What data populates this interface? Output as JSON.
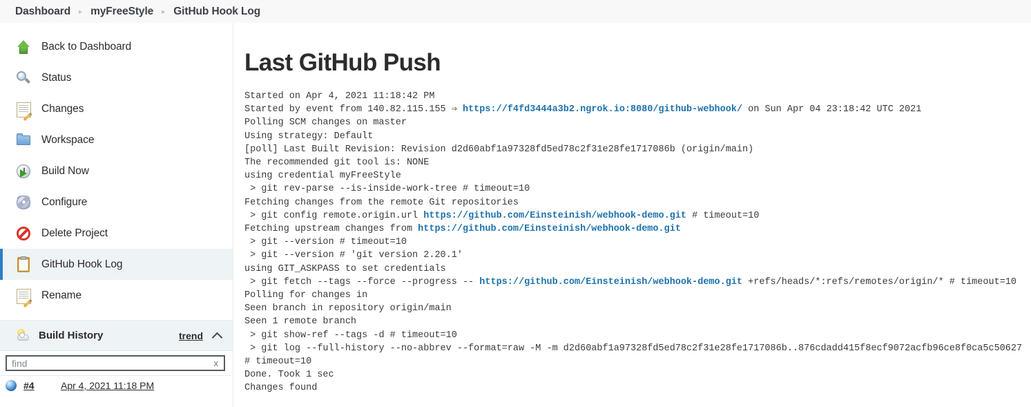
{
  "breadcrumb": {
    "items": [
      {
        "label": "Dashboard"
      },
      {
        "label": "myFreeStyle"
      },
      {
        "label": "GitHub Hook Log"
      }
    ],
    "separator": "▸"
  },
  "sidebar": {
    "tasks": [
      {
        "label": "Back to Dashboard",
        "icon": "arrow-up-icon",
        "active": false
      },
      {
        "label": "Status",
        "icon": "magnifier-icon",
        "active": false
      },
      {
        "label": "Changes",
        "icon": "notepad-pencil-icon",
        "active": false
      },
      {
        "label": "Workspace",
        "icon": "folder-icon",
        "active": false
      },
      {
        "label": "Build Now",
        "icon": "clock-play-icon",
        "active": false
      },
      {
        "label": "Configure",
        "icon": "gear-icon",
        "active": false
      },
      {
        "label": "Delete Project",
        "icon": "deny-icon",
        "active": false
      },
      {
        "label": "GitHub Hook Log",
        "icon": "clipboard-icon",
        "active": true
      },
      {
        "label": "Rename",
        "icon": "notepad-pencil-icon",
        "active": false
      }
    ],
    "build_history": {
      "title": "Build History",
      "icon": "weather-sun-cloud-icon",
      "trend_label": "trend",
      "collapse_icon": "chevron-up-icon",
      "find": {
        "value": "",
        "placeholder": "find",
        "clear_label": "x"
      },
      "builds": [
        {
          "number": "#4",
          "date": "Apr 4, 2021 11:18 PM",
          "status_icon": "blue-ball-icon"
        }
      ]
    }
  },
  "main": {
    "title": "Last GitHub Push",
    "console": {
      "lines": [
        {
          "segments": [
            {
              "text": "Started on Apr 4, 2021 11:18:42 PM",
              "link": false
            }
          ]
        },
        {
          "segments": [
            {
              "text": "Started by event from 140.82.115.155 ⇒ ",
              "link": false
            },
            {
              "text": "https://f4fd3444a3b2.ngrok.io:8080/github-webhook/",
              "link": true
            },
            {
              "text": " on Sun Apr 04 23:18:42 UTC 2021",
              "link": false
            }
          ]
        },
        {
          "segments": [
            {
              "text": "Polling SCM changes on master",
              "link": false
            }
          ]
        },
        {
          "segments": [
            {
              "text": "Using strategy: Default",
              "link": false
            }
          ]
        },
        {
          "segments": [
            {
              "text": "[poll] Last Built Revision: Revision d2d60abf1a97328fd5ed78c2f31e28fe1717086b (origin/main)",
              "link": false
            }
          ]
        },
        {
          "segments": [
            {
              "text": "The recommended git tool is: NONE",
              "link": false
            }
          ]
        },
        {
          "segments": [
            {
              "text": "using credential myFreeStyle",
              "link": false
            }
          ]
        },
        {
          "segments": [
            {
              "text": " > git rev-parse --is-inside-work-tree # timeout=10",
              "link": false
            }
          ]
        },
        {
          "segments": [
            {
              "text": "Fetching changes from the remote Git repositories",
              "link": false
            }
          ]
        },
        {
          "segments": [
            {
              "text": " > git config remote.origin.url ",
              "link": false
            },
            {
              "text": "https://github.com/Einsteinish/webhook-demo.git",
              "link": true
            },
            {
              "text": " # timeout=10",
              "link": false
            }
          ]
        },
        {
          "segments": [
            {
              "text": "Fetching upstream changes from ",
              "link": false
            },
            {
              "text": "https://github.com/Einsteinish/webhook-demo.git",
              "link": true
            }
          ]
        },
        {
          "segments": [
            {
              "text": " > git --version # timeout=10",
              "link": false
            }
          ]
        },
        {
          "segments": [
            {
              "text": " > git --version # 'git version 2.20.1'",
              "link": false
            }
          ]
        },
        {
          "segments": [
            {
              "text": "using GIT_ASKPASS to set credentials",
              "link": false
            }
          ]
        },
        {
          "segments": [
            {
              "text": " > git fetch --tags --force --progress -- ",
              "link": false
            },
            {
              "text": "https://github.com/Einsteinish/webhook-demo.git",
              "link": true
            },
            {
              "text": " +refs/heads/*:refs/remotes/origin/* # timeout=10",
              "link": false
            }
          ]
        },
        {
          "segments": [
            {
              "text": "Polling for changes in",
              "link": false
            }
          ]
        },
        {
          "segments": [
            {
              "text": "Seen branch in repository origin/main",
              "link": false
            }
          ]
        },
        {
          "segments": [
            {
              "text": "Seen 1 remote branch",
              "link": false
            }
          ]
        },
        {
          "segments": [
            {
              "text": " > git show-ref --tags -d # timeout=10",
              "link": false
            }
          ]
        },
        {
          "segments": [
            {
              "text": " > git log --full-history --no-abbrev --format=raw -M -m d2d60abf1a97328fd5ed78c2f31e28fe1717086b..876cdadd415f8ecf9072acfb96ce8f0ca5c50627 # timeout=10",
              "link": false
            }
          ]
        },
        {
          "segments": [
            {
              "text": "Done. Took 1 sec",
              "link": false
            }
          ]
        },
        {
          "segments": [
            {
              "text": "Changes found",
              "link": false
            }
          ]
        }
      ]
    }
  },
  "colors": {
    "link": "#1d72ab",
    "active_accent": "#2d7ec4",
    "active_bg": "#eef3f6",
    "breadcrumb_bg": "#f8f8f8",
    "text": "#2c2c2c"
  }
}
